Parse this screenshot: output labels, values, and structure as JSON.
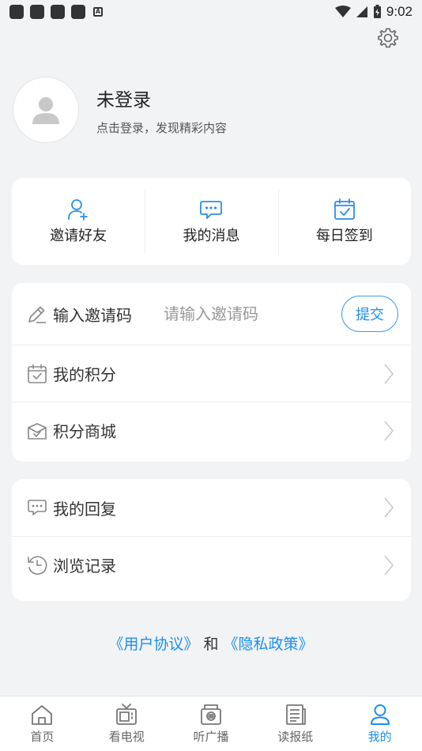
{
  "status_bar": {
    "time": "9:02"
  },
  "profile": {
    "title": "未登录",
    "subtitle": "点击登录，发现精彩内容"
  },
  "quick_actions": [
    {
      "label": "邀请好友",
      "icon": "add-user-icon"
    },
    {
      "label": "我的消息",
      "icon": "message-icon"
    },
    {
      "label": "每日签到",
      "icon": "calendar-check-icon"
    }
  ],
  "invite": {
    "label": "输入邀请码",
    "placeholder": "请输入邀请码",
    "submit": "提交"
  },
  "menu1": [
    {
      "label": "我的积分",
      "icon": "calendar-check-icon"
    },
    {
      "label": "积分商城",
      "icon": "gift-icon"
    }
  ],
  "menu2": [
    {
      "label": "我的回复",
      "icon": "reply-icon"
    },
    {
      "label": "浏览记录",
      "icon": "history-icon"
    }
  ],
  "agreement": {
    "user": "《用户协议》",
    "and": "和",
    "privacy": "《隐私政策》"
  },
  "tabs": [
    {
      "label": "首页",
      "icon": "home-icon"
    },
    {
      "label": "看电视",
      "icon": "tv-icon"
    },
    {
      "label": "听广播",
      "icon": "radio-icon"
    },
    {
      "label": "读报纸",
      "icon": "newspaper-icon"
    },
    {
      "label": "我的",
      "icon": "user-icon",
      "active": true
    }
  ],
  "colors": {
    "accent": "#1a8ff0",
    "background": "#f2f3f5"
  }
}
